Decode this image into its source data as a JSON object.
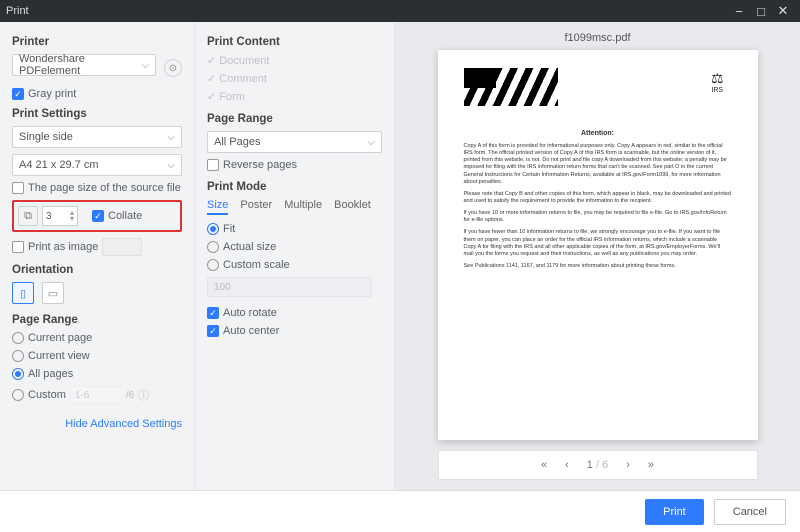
{
  "window": {
    "title": "Print"
  },
  "printer": {
    "section": "Printer",
    "selected": "Wondershare PDFelement",
    "gray_print": "Gray print",
    "settings_section": "Print Settings",
    "sides": "Single side",
    "paper": "A4 21 x 29.7 cm",
    "page_size_source": "The page size of the source file",
    "copies_value": "3",
    "collate": "Collate",
    "print_as_image": "Print as image",
    "orientation_section": "Orientation",
    "page_range_section": "Page Range",
    "current_page": "Current page",
    "current_view": "Current view",
    "all_pages": "All pages",
    "custom": "Custom",
    "custom_placeholder": "1-6",
    "total_pages": "/6",
    "hide_link": "Hide Advanced Settings"
  },
  "content": {
    "section": "Print Content",
    "document": "Document",
    "comment": "Comment",
    "form": "Form",
    "range_section": "Page Range",
    "range_value": "All Pages",
    "reverse": "Reverse pages",
    "mode_section": "Print Mode",
    "tabs": {
      "size": "Size",
      "poster": "Poster",
      "multiple": "Multiple",
      "booklet": "Booklet"
    },
    "fit": "Fit",
    "actual": "Actual size",
    "custom_scale": "Custom scale",
    "scale_value": "100",
    "auto_rotate": "Auto rotate",
    "auto_center": "Auto center"
  },
  "preview": {
    "filename": "f1099msc.pdf",
    "irs_label": "IRS",
    "attention": "Attention:",
    "p1": "Copy A of this form is provided for informational purposes only. Copy A appears in red, similar to the official IRS form. The official printed version of Copy A of this IRS form is scannable, but the online version of it, printed from this website, is not. Do not print and file copy A downloaded from this website; a penalty may be imposed for filing with the IRS information return forms that can't be scanned. See part O in the current General Instructions for Certain Information Returns, available at IRS.gov/Form1099, for more information about penalties.",
    "p2": "Please note that Copy B and other copies of this form, which appear in black, may be downloaded and printed and used to satisfy the requirement to provide the information to the recipient.",
    "p3": "If you have 10 or more information returns to file, you may be required to file e-file. Go to IRS.gov/InfoReturn for e-file options.",
    "p4": "If you have fewer than 10 information returns to file, we strongly encourage you to e-file. If you want to file them on paper, you can place an order for the official IRS information returns, which include a scannable Copy A for filing with the IRS and all other applicable copies of the form, at IRS.gov/EmployerForms. We'll mail you the forms you request and their instructions, as well as any publications you may order.",
    "p5": "See Publications 1141, 1167, and 1179 for more information about printing these forms.",
    "page_indicator": "1",
    "page_total": "/ 6"
  },
  "footer": {
    "print": "Print",
    "cancel": "Cancel"
  }
}
